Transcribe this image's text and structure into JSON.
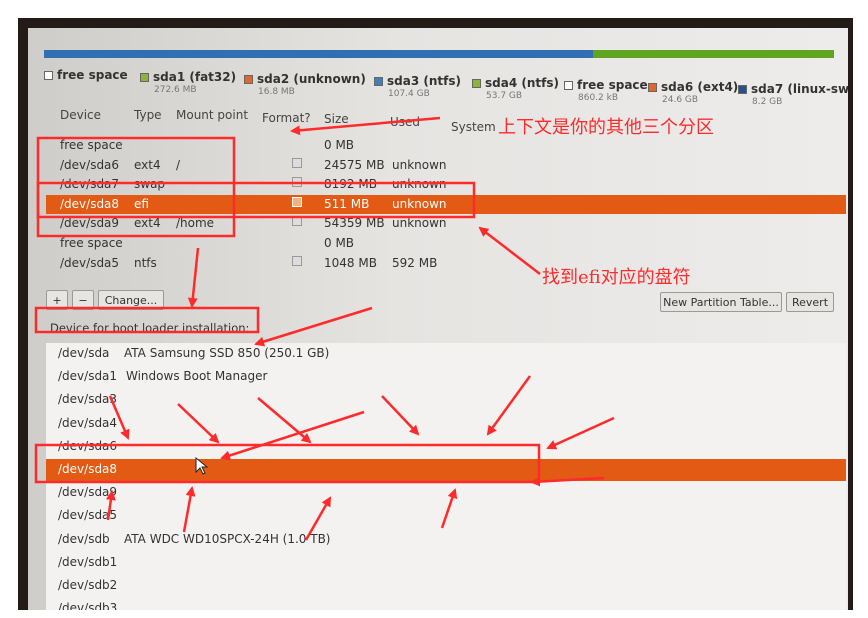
{
  "partition_bar": {
    "segments": [
      {
        "color": "#2f6fb2",
        "fraction": 0.695
      },
      {
        "color": "#5fa521",
        "fraction": 0.305
      }
    ]
  },
  "legend": [
    {
      "name": "free space",
      "size": "",
      "color": "#ffffff"
    },
    {
      "name": "sda1 (fat32)",
      "size": "272.6 MB",
      "color": "#8bb43a"
    },
    {
      "name": "sda2 (unknown)",
      "size": "16.8 MB",
      "color": "#e0662a"
    },
    {
      "name": "sda3 (ntfs)",
      "size": "107.4 GB",
      "color": "#3f7fc0"
    },
    {
      "name": "sda4 (ntfs)",
      "size": "53.7 GB",
      "color": "#8bb43a"
    },
    {
      "name": "free space",
      "size": "860.2 kB",
      "color": "#ffffff"
    },
    {
      "name": "sda6 (ext4)",
      "size": "24.6 GB",
      "color": "#e0662a"
    },
    {
      "name": "sda7 (linux-sw",
      "size": "8.2 GB",
      "color": "#2b4f8a"
    }
  ],
  "table": {
    "headers": {
      "device": "Device",
      "type": "Type",
      "mount": "Mount point",
      "format": "Format?",
      "size": "Size",
      "used": "Used",
      "system": "System"
    },
    "rows": [
      {
        "device": "free space",
        "type": "",
        "mount": "",
        "format": false,
        "size": "0 MB",
        "used": ""
      },
      {
        "device": "/dev/sda6",
        "type": "ext4",
        "mount": "/",
        "format": true,
        "size": "24575 MB",
        "used": "unknown"
      },
      {
        "device": "/dev/sda7",
        "type": "swap",
        "mount": "",
        "format": false,
        "size": "8192 MB",
        "used": "unknown"
      },
      {
        "device": "/dev/sda8",
        "type": "efi",
        "mount": "",
        "format": true,
        "size": "511 MB",
        "used": "unknown"
      },
      {
        "device": "/dev/sda9",
        "type": "ext4",
        "mount": "/home",
        "format": true,
        "size": "54359 MB",
        "used": "unknown"
      },
      {
        "device": "free space",
        "type": "",
        "mount": "",
        "format": false,
        "size": "0 MB",
        "used": ""
      },
      {
        "device": "/dev/sda5",
        "type": "ntfs",
        "mount": "",
        "format": false,
        "size": "1048 MB",
        "used": "592 MB"
      }
    ],
    "selected_row": "/dev/sda8"
  },
  "toolbar": {
    "add_label": "+",
    "remove_label": "−",
    "change_label": "Change...",
    "new_table_label": "New Partition Table...",
    "revert_label": "Revert"
  },
  "bootloader": {
    "label": "Device for boot loader installation:",
    "items": [
      {
        "device": "/dev/sda",
        "desc": "ATA Samsung SSD 850 (250.1 GB)"
      },
      {
        "device": "/dev/sda1",
        "desc": "Windows Boot Manager"
      },
      {
        "device": "/dev/sda3",
        "desc": ""
      },
      {
        "device": "/dev/sda4",
        "desc": ""
      },
      {
        "device": "/dev/sda6",
        "desc": ""
      },
      {
        "device": "/dev/sda8",
        "desc": ""
      },
      {
        "device": "/dev/sda9",
        "desc": ""
      },
      {
        "device": "/dev/sda5",
        "desc": ""
      },
      {
        "device": "/dev/sdb",
        "desc": "ATA WDC WD10SPCX-24H (1.0 TB)"
      },
      {
        "device": "/dev/sdb1",
        "desc": ""
      },
      {
        "device": "/dev/sdb2",
        "desc": ""
      },
      {
        "device": "/dev/sdb3",
        "desc": ""
      }
    ],
    "selected": "/dev/sda8"
  },
  "annotations": {
    "text_top": "上下文是你的其他三个分区",
    "text_mid": "找到efi对应的盘符",
    "color": "#ff2a2a"
  }
}
